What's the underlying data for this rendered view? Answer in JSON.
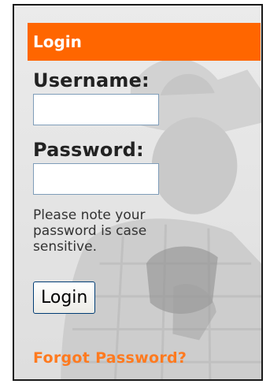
{
  "panel": {
    "header_title": "Login",
    "accent_color": "#ff6600",
    "link_color": "#ff7a1f"
  },
  "form": {
    "username_label": "Username:",
    "username_value": "",
    "password_label": "Password:",
    "password_value": "",
    "note": "Please note your password is case sensitive.",
    "submit_label": "Login",
    "forgot_link": "Forgot Password?"
  },
  "background": {
    "subject": "grayscale photo of a cowboy in a hat and plaid shirt"
  }
}
